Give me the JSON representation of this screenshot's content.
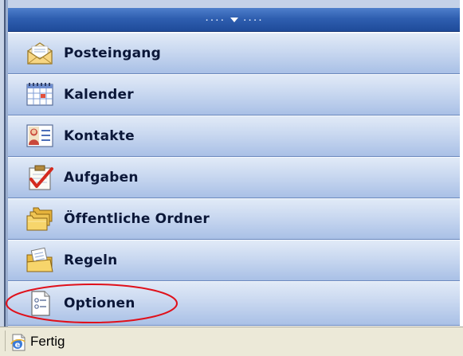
{
  "navigation_pane": {
    "splitter_grip": {
      "dots_left": "....",
      "dots_right": "....",
      "arrow_icon": "chevron-down-icon"
    },
    "items": [
      {
        "label": "Posteingang",
        "icon": "envelope-icon"
      },
      {
        "label": "Kalender",
        "icon": "calendar-icon"
      },
      {
        "label": "Kontakte",
        "icon": "contact-card-icon"
      },
      {
        "label": "Aufgaben",
        "icon": "task-checkmark-icon"
      },
      {
        "label": "Öffentliche Ordner",
        "icon": "public-folders-icon"
      },
      {
        "label": "Regeln",
        "icon": "rules-folder-icon"
      },
      {
        "label": "Optionen",
        "icon": "options-document-icon"
      }
    ],
    "highlighted_item": "Optionen",
    "highlight_color": "#e0101a"
  },
  "status_bar": {
    "icon": "ie-page-icon",
    "text": "Fertig"
  },
  "colors": {
    "nav_item_top": "#e1eaf7",
    "nav_item_bottom": "#a9c0e6",
    "splitter": "#2f5fb0",
    "status_bar_bg": "#ece9d8"
  }
}
